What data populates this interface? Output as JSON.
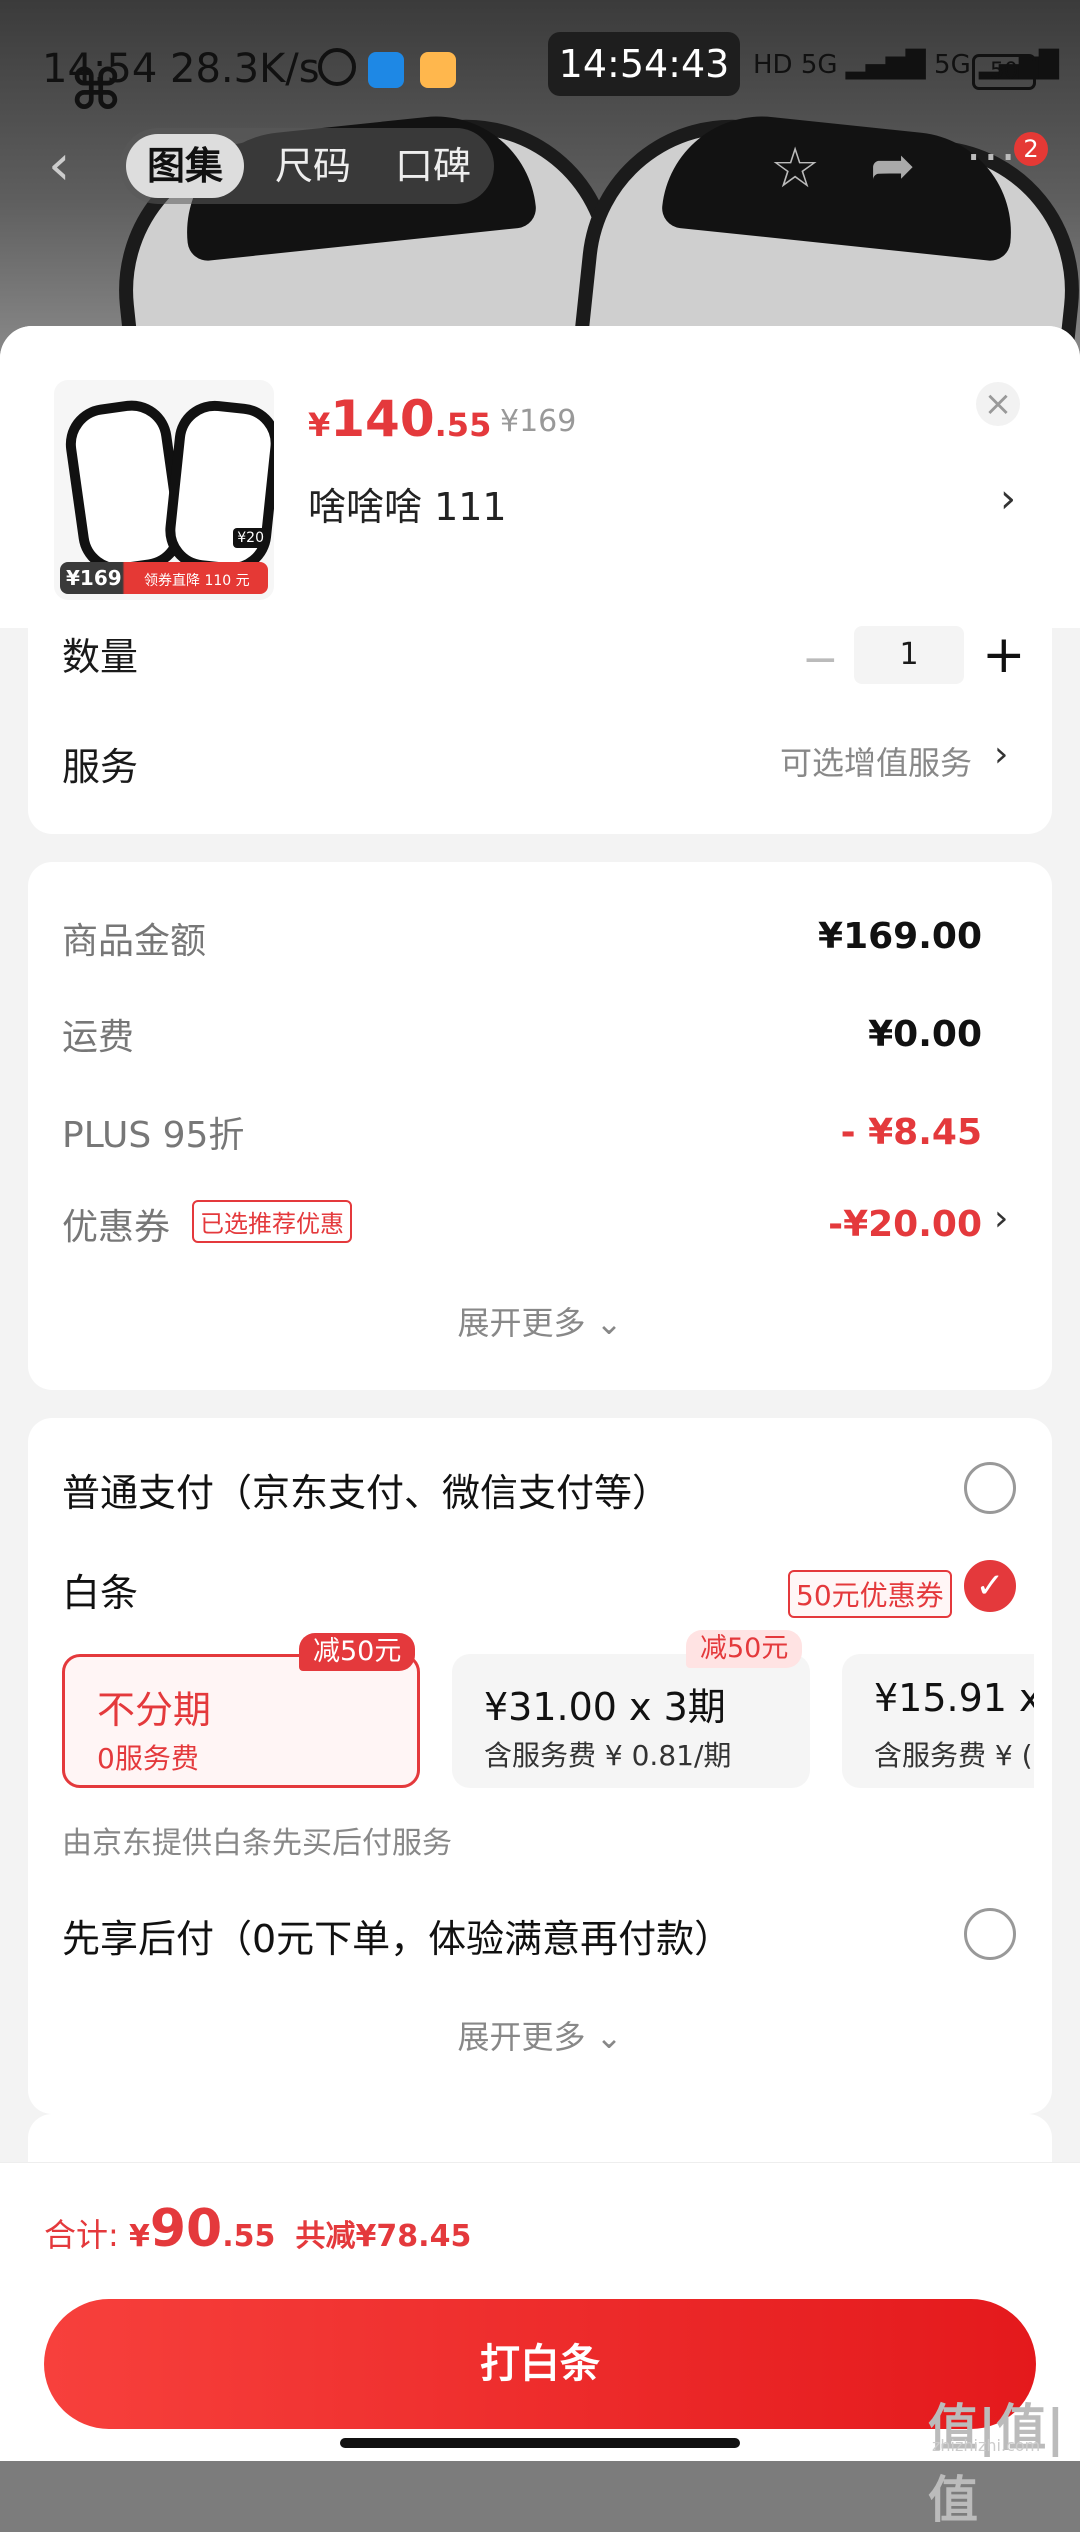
{
  "status_bar": {
    "time_left": "14:54",
    "speed": "28.3K/s",
    "clock": "14:54:43",
    "network": "HD 5G ▂▄▆█ 5G ▂▄▆█",
    "battery": "50"
  },
  "nav": {
    "tabs": [
      "图集",
      "尺码",
      "口碑"
    ],
    "more_badge": "2"
  },
  "product": {
    "price_symbol": "¥",
    "price_int": "140",
    "price_dec": ".55",
    "original_price": "¥169",
    "sku_name": "啥啥啥  111",
    "thumb_price": "¥169",
    "thumb_promo": "领券直降 110 元",
    "thumb_coupon": "¥20"
  },
  "quantity": {
    "label": "数量",
    "value": "1",
    "minus": "−",
    "plus": "+"
  },
  "service": {
    "label": "服务",
    "hint": "可选增值服务"
  },
  "amounts": {
    "rows": [
      {
        "label": "商品金额",
        "value": "¥169.00"
      },
      {
        "label": "运费",
        "value": "¥0.00"
      },
      {
        "label": "PLUS 95折",
        "value": "- ¥8.45"
      },
      {
        "label": "优惠券",
        "value": "-¥20.00"
      }
    ],
    "coupon_badge": "已选推荐优惠",
    "expand": "展开更多 ⌄"
  },
  "payment": {
    "normal": "普通支付（京东支付、微信支付等）",
    "baitiao": "白条",
    "baitiao_coupon": "50元优惠券",
    "plans": [
      {
        "main": "不分期",
        "sub": "0服务费",
        "badge": "减50元"
      },
      {
        "main": "¥31.00 x 3期",
        "sub": "含服务费 ¥ 0.81/期",
        "badge": "减50元"
      },
      {
        "main": "¥15.91 x",
        "sub": "含服务费 ¥ ("
      }
    ],
    "baitiao_note": "由京东提供白条先买后付服务",
    "later": "先享后付（0元下单，体验满意再付款）",
    "expand": "展开更多 ⌄"
  },
  "footer": {
    "total_label": "合计:",
    "total_symbol": "¥",
    "total_int": "90",
    "total_dec": ".55",
    "saved": "共减¥78.45",
    "pay_button": "打白条"
  },
  "watermark": {
    "logo": "值|值|值",
    "site": "zhizhizhi.com"
  },
  "colors": {
    "accent": "#e4393c",
    "button": "#f7403c"
  }
}
